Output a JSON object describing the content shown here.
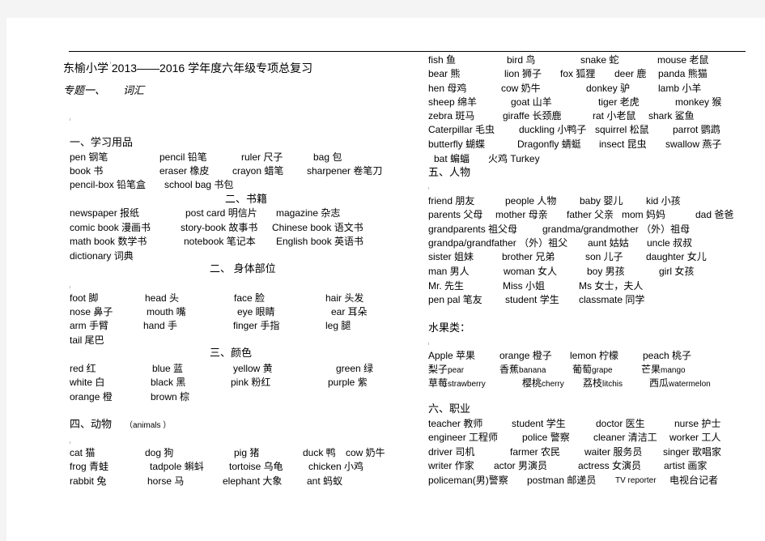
{
  "document": {
    "title": "东榆小学 2013——2016 学年度六年级专项总复习",
    "topic_number": "专题一、",
    "topic_name": "词汇"
  },
  "sections": {
    "school_supplies": {
      "heading": "一、学习用品",
      "items": [
        "pen 钢笔",
        "pencil 铅笔",
        "ruler 尺子",
        "bag 包",
        "book 书",
        "eraser 橡皮",
        "crayon 蜡笔",
        "sharpener 卷笔刀",
        "pencil-box 铅笔盒",
        "school bag 书包"
      ]
    },
    "books": {
      "heading": "二、书籍",
      "items": [
        "newspaper 报纸",
        "post card 明信片",
        "magazine 杂志",
        "comic book 漫画书",
        "story-book 故事书",
        "Chinese book 语文书",
        "math book 数学书",
        "notebook 笔记本",
        "English book 英语书",
        "dictionary 词典"
      ]
    },
    "body_parts": {
      "heading": "二、 身体部位",
      "items": [
        "foot 脚",
        "head 头",
        "face 脸",
        "hair 头发",
        "nose 鼻子",
        "mouth 嘴",
        "eye 眼睛",
        "ear 耳朵",
        "arm 手臂",
        "hand 手",
        "finger 手指",
        "leg 腿",
        "tail 尾巴"
      ]
    },
    "colors": {
      "heading": "三、颜色",
      "items": [
        "red 红",
        "blue 蓝",
        "yellow 黄",
        "green 绿",
        "white 白",
        "black 黑",
        "pink 粉红",
        "purple 紫",
        "orange 橙",
        "brown 棕"
      ]
    },
    "animals": {
      "heading": "四、动物",
      "heading_en": "（animals ）",
      "items": [
        "cat 猫",
        "dog 狗",
        "pig 猪",
        "duck 鸭",
        "cow 奶牛",
        "frog 青蛙",
        "tadpole 蝌蚪",
        "tortoise 乌龟",
        "chicken 小鸡",
        "rabbit 兔",
        "horse 马",
        "elephant 大象",
        "ant 蚂蚁",
        "fish 鱼",
        "bird 鸟",
        "snake 蛇",
        "mouse 老鼠",
        "bear 熊",
        "lion 狮子",
        "fox 狐狸",
        "deer 鹿",
        "panda 熊猫",
        "hen 母鸡",
        "cow 奶牛",
        "donkey 驴",
        "lamb 小羊",
        "sheep 绵羊",
        "goat 山羊",
        "tiger 老虎",
        "monkey 猴",
        "zebra 斑马",
        "giraffe 长颈鹿",
        "rat 小老鼠",
        "shark 鲨鱼",
        "Caterpillar 毛虫",
        "duckling 小鸭子",
        "squirrel 松鼠",
        "parrot 鹦鹉",
        "butterfly 蝴蝶",
        "Dragonfly 蜻蜓",
        "insect 昆虫",
        "swallow 燕子",
        "bat 蝙蝠",
        "火鸡 Turkey"
      ]
    },
    "people": {
      "heading": "五、人物",
      "items": [
        "friend 朋友",
        "people 人物",
        "baby 婴儿",
        "kid 小孩",
        "parents 父母",
        "mother 母亲",
        "father 父亲",
        "mom 妈妈",
        "dad 爸爸",
        "grandparents 祖父母",
        "grandma/grandmother （外）祖母",
        "grandpa/grandfather （外）祖父",
        "aunt 姑姑",
        "uncle 叔叔",
        "sister 姐妹",
        "brother 兄弟",
        "son 儿子",
        "daughter 女儿",
        "man 男人",
        "woman 女人",
        "boy 男孩",
        "girl 女孩",
        "Mr. 先生",
        "Miss 小姐",
        "Ms 女士，夫人",
        "pen pal 笔友",
        "student 学生",
        "classmate 同学"
      ]
    },
    "fruits": {
      "heading": "水果类：",
      "items": [
        "Apple 苹果",
        "orange 橙子",
        "lemon 柠檬",
        "peach 桃子"
      ],
      "items_cn_first": [
        {
          "cn": "梨子",
          "en": "pear"
        },
        {
          "cn": "香蕉",
          "en": "banana"
        },
        {
          "cn": "葡萄",
          "en": "grape"
        },
        {
          "cn": "芒果",
          "en": "mango"
        },
        {
          "cn": "草莓",
          "en": "strawberry"
        },
        {
          "cn": "樱桃",
          "en": "cherry"
        },
        {
          "cn": "荔枝",
          "en": "litchis"
        },
        {
          "cn": "西瓜",
          "en": "watermelon"
        }
      ]
    },
    "jobs": {
      "heading": "六、职业",
      "items": [
        "teacher 教师",
        "student 学生",
        "doctor 医生",
        "nurse 护士",
        "engineer 工程师",
        "police 警察",
        "cleaner 清洁工",
        "worker 工人",
        "driver 司机",
        "farmer 农民",
        "waiter 服务员",
        "singer 歌唱家",
        "writer 作家",
        "actor 男演员",
        "actress 女演员",
        "artist 画家",
        "policeman(男)警察",
        "postman 邮递员",
        "TV reporter",
        "电视台记者"
      ]
    }
  }
}
